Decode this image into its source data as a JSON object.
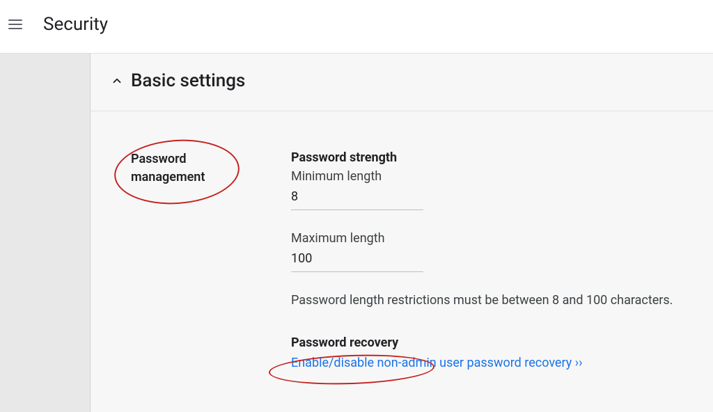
{
  "header": {
    "title": "Security"
  },
  "section": {
    "title": "Basic settings"
  },
  "sideLabel": {
    "line1": "Password",
    "line2": "management"
  },
  "passwordStrength": {
    "heading": "Password strength",
    "minLabel": "Minimum length",
    "minValue": "8",
    "maxLabel": "Maximum length",
    "maxValue": "100",
    "helpText": "Password length restrictions must be between 8 and 100 characters."
  },
  "passwordRecovery": {
    "heading": "Password recovery",
    "linkText": "Enable/disable non-admin user password recovery ››"
  }
}
